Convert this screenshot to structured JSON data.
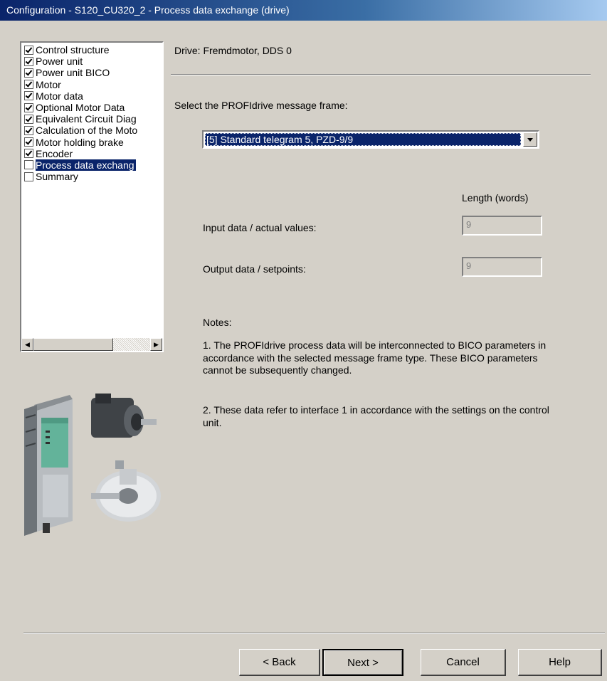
{
  "window": {
    "title": "Configuration - S120_CU320_2 - Process data exchange (drive)"
  },
  "nav": {
    "items": [
      {
        "label": "Control structure",
        "checked": true
      },
      {
        "label": "Power unit",
        "checked": true
      },
      {
        "label": "Power unit BICO",
        "checked": true
      },
      {
        "label": "Motor",
        "checked": true
      },
      {
        "label": "Motor data",
        "checked": true
      },
      {
        "label": "Optional Motor Data",
        "checked": true
      },
      {
        "label": "Equivalent Circuit Diag",
        "checked": true
      },
      {
        "label": "Calculation of the Moto",
        "checked": true
      },
      {
        "label": "Motor holding brake",
        "checked": true
      },
      {
        "label": "Encoder",
        "checked": true
      },
      {
        "label": "Process data exchang",
        "checked": false,
        "selected": true
      },
      {
        "label": "Summary",
        "checked": false
      }
    ]
  },
  "main": {
    "drive_label": "Drive: Fremdmotor, DDS 0",
    "frame_label": "Select the PROFIdrive message frame:",
    "frame_selected": "[5] Standard telegram 5, PZD-9/9",
    "length_header": "Length (words)",
    "input_label": "Input data / actual values:",
    "input_value": "9",
    "output_label": "Output data / setpoints:",
    "output_value": "9",
    "notes_title": "Notes:",
    "note1": "1. The PROFIdrive process data will be interconnected to BICO parameters in accordance with the selected message frame type. These BICO parameters cannot be subsequently changed.",
    "note2": "2. These data refer to interface 1 in accordance with the settings on the control unit."
  },
  "buttons": {
    "back": "< Back",
    "next": "Next >",
    "cancel": "Cancel",
    "help": "Help"
  },
  "icons": {
    "checkbox_checked": "checkbox-checked-icon",
    "scroll_left": "arrow-left-icon",
    "scroll_right": "arrow-right-icon",
    "dropdown": "chevron-down-icon"
  },
  "colors": {
    "titlebar": "#0a246a",
    "selection": "#0a246a",
    "dialog_bg": "#d4d0c8"
  }
}
